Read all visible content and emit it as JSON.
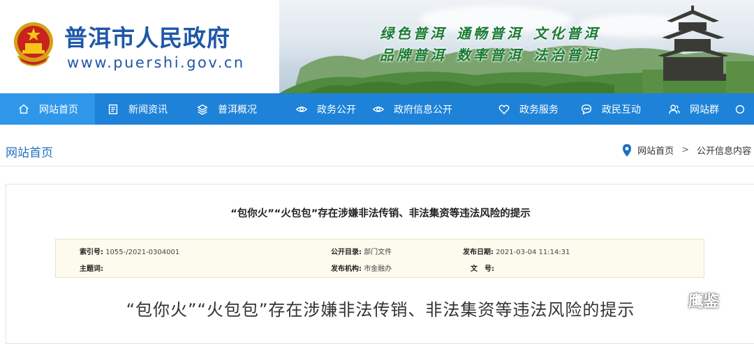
{
  "header": {
    "site_title": "普洱市人民政府",
    "site_url": "www.puershi.gov.cn",
    "slogans_row1": [
      "绿色普洱",
      "通畅普洱",
      "文化普洱"
    ],
    "slogans_row2": [
      "品牌普洱",
      "数率普洱",
      "法治普洱"
    ]
  },
  "nav": {
    "items": [
      {
        "label": "网站首页",
        "icon": "home-icon",
        "active": true
      },
      {
        "label": "新闻资讯",
        "icon": "news-icon"
      },
      {
        "label": "普洱概况",
        "icon": "layers-icon"
      },
      {
        "label": "政务公开",
        "icon": "eye-icon"
      },
      {
        "label": "政府信息公开",
        "icon": "eye-icon"
      },
      {
        "label": "政务服务",
        "icon": "heart-icon"
      },
      {
        "label": "政民互动",
        "icon": "chat-icon"
      },
      {
        "label": "网站群",
        "icon": "users-icon"
      }
    ]
  },
  "breadcrumb": {
    "section": "网站首页",
    "path": [
      "网站首页",
      "公开信息内容"
    ],
    "separator": ">"
  },
  "article": {
    "title": "“包你火”“火包包”存在涉嫌非法传销、非法集资等违法风险的提示",
    "meta": {
      "index_label": "索引号:",
      "index_value": "1055-/2021-0304001",
      "catalog_label": "公开目录:",
      "catalog_value": "部门文件",
      "date_label": "发布日期:",
      "date_value": "2021-03-04 11:14:31",
      "subject_label": "主题词:",
      "subject_value": "",
      "org_label": "发布机构:",
      "org_value": "市金融办",
      "doc_label": "文　号:",
      "doc_value": ""
    },
    "headline": "“包你火”“火包包”存在涉嫌非法传销、非法集资等违法风险的提示"
  },
  "watermark": {
    "text": "鹰鉴"
  },
  "colors": {
    "nav_bg": "#1e82d8",
    "nav_active": "#2e97ea",
    "title_blue": "#1f57a8",
    "slogan_green": "#1a7a34"
  }
}
